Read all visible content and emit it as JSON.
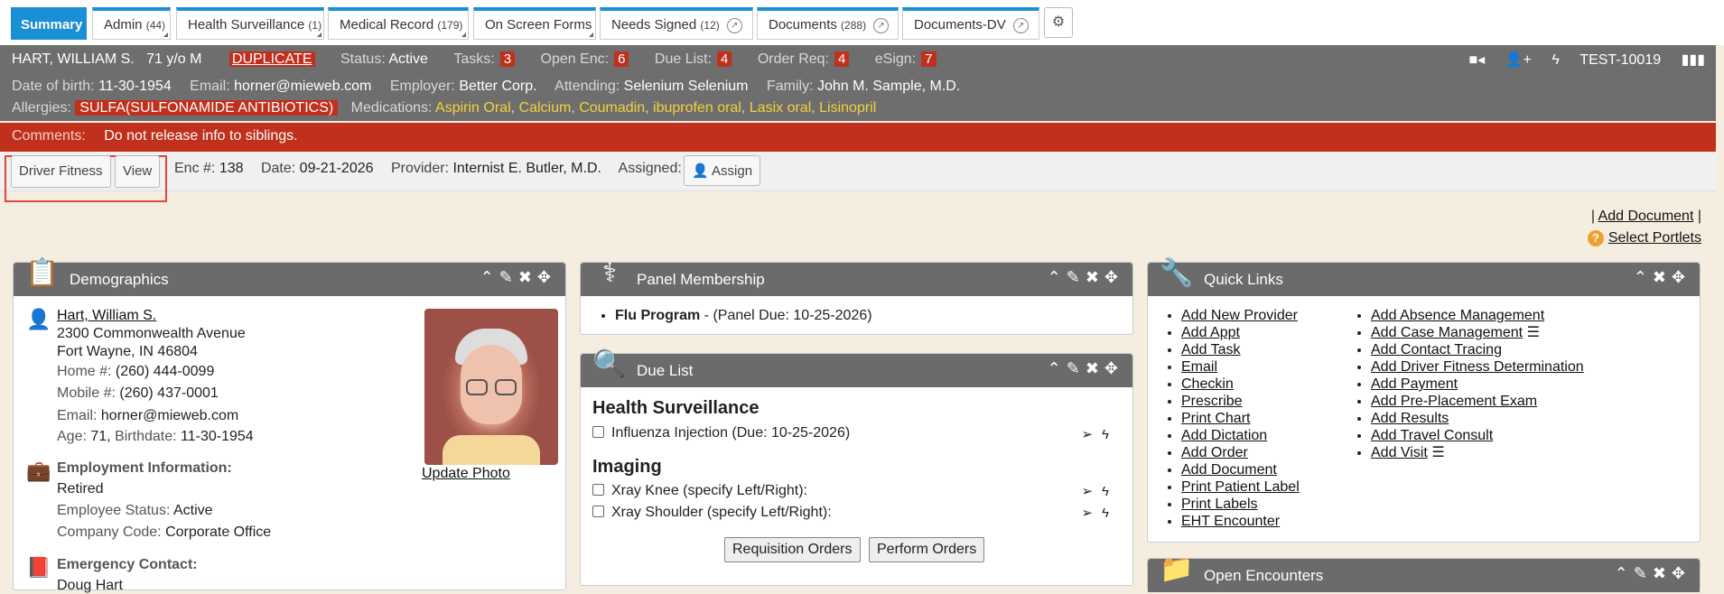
{
  "tabs": [
    {
      "label": "Summary",
      "count": "",
      "active": true
    },
    {
      "label": "Admin",
      "count": "(44)"
    },
    {
      "label": "Health Surveillance",
      "count": "(1)"
    },
    {
      "label": "Medical Record",
      "count": "(179)"
    },
    {
      "label": "On Screen Forms",
      "count": ""
    },
    {
      "label": "Needs Signed",
      "count": "(12)"
    },
    {
      "label": "Documents",
      "count": "(288)"
    },
    {
      "label": "Documents-DV",
      "count": ""
    }
  ],
  "patient": {
    "name": "HART, WILLIAM S.",
    "age_sex": "71 y/o M",
    "duplicate": "DUPLICATE",
    "status_label": "Status:",
    "status": "Active",
    "tasks_label": "Tasks:",
    "tasks": "3",
    "open_enc_label": "Open Enc:",
    "open_enc": "6",
    "due_list_label": "Due List:",
    "due_list": "4",
    "order_req_label": "Order Req:",
    "order_req": "4",
    "esign_label": "eSign:",
    "esign": "7",
    "chart_id": "TEST-10019",
    "dob_label": "Date of birth:",
    "dob": "11-30-1954",
    "email_label": "Email:",
    "email": "horner@mieweb.com",
    "employer_label": "Employer:",
    "employer": "Better Corp.",
    "attending_label": "Attending:",
    "attending": "Selenium Selenium",
    "family_label": "Family:",
    "family": "John M. Sample, M.D.",
    "allergies_label": "Allergies:",
    "allergy": "SULFA(SULFONAMIDE ANTIBIOTICS)",
    "medications_label": "Medications:",
    "medications": [
      "Aspirin Oral",
      "Calcium",
      "Coumadin",
      "ibuprofen oral",
      "Lasix oral",
      "Lisinopril"
    ]
  },
  "comments": {
    "label": "Comments:",
    "text": "Do not release info to siblings."
  },
  "encounter": {
    "driver_fitness": "Driver Fitness",
    "view": "View",
    "enc_label": "Enc #:",
    "enc": "138",
    "date_label": "Date:",
    "date": "09-21-2026",
    "provider_label": "Provider:",
    "provider": "Internist E. Butler, M.D.",
    "assigned_label": "Assigned:",
    "assign": "Assign"
  },
  "top_links": {
    "add_document": "Add Document",
    "select_portlets": "Select Portlets",
    "sep": "|"
  },
  "demographics": {
    "title": "Demographics",
    "name": "Hart, William S.",
    "address1": "2300 Commonwealth Avenue",
    "address2": "Fort Wayne, IN 46804",
    "home_label": "Home #:",
    "home": "(260) 444-0099",
    "mobile_label": "Mobile #:",
    "mobile": "(260) 437-0001",
    "email_label": "Email:",
    "email": "horner@mieweb.com",
    "age_label": "Age:",
    "age": "71,",
    "birthdate_label": "Birthdate:",
    "birthdate": "11-30-1954",
    "employment_title": "Employment Information:",
    "employment": "Retired",
    "emp_status_label": "Employee Status:",
    "emp_status": "Active",
    "company_label": "Company Code:",
    "company": "Corporate Office",
    "emergency_title": "Emergency Contact:",
    "emergency_name": "Doug Hart",
    "update_photo": "Update Photo"
  },
  "panel": {
    "title": "Panel Membership",
    "program": "Flu Program",
    "due": " - (Panel Due: 10-25-2026)"
  },
  "due_list": {
    "title": "Due List",
    "sections": [
      {
        "title": "Health Surveillance",
        "items": [
          "Influenza Injection (Due: 10-25-2026)"
        ]
      },
      {
        "title": "Imaging",
        "items": [
          "Xray Knee (specify Left/Right):",
          "Xray Shoulder (specify Left/Right):"
        ]
      }
    ],
    "requisition": "Requisition Orders",
    "perform": "Perform Orders"
  },
  "quick_links": {
    "title": "Quick Links",
    "col1": [
      "Add New Provider",
      "Add Appt",
      "Add Task",
      "Email",
      "Checkin",
      "Prescribe",
      "Print Chart",
      "Add Dictation",
      "Add Order",
      "Add Document",
      "Print Patient Label",
      "Print Labels",
      "EHT Encounter"
    ],
    "col2": [
      "Add Absence Management",
      "Add Case Management",
      "Add Contact Tracing",
      "Add Driver Fitness Determination",
      "Add Payment",
      "Add Pre-Placement Exam",
      "Add Results",
      "Add Travel Consult",
      "Add Visit"
    ]
  },
  "open_encounters": {
    "title": "Open Encounters"
  },
  "colors": {
    "tab_blue": "#1b8fd6",
    "header_gray": "#6e6e6e",
    "alert_red": "#c0301d",
    "med_yellow": "#f2d23a",
    "background": "#f5eee0"
  }
}
